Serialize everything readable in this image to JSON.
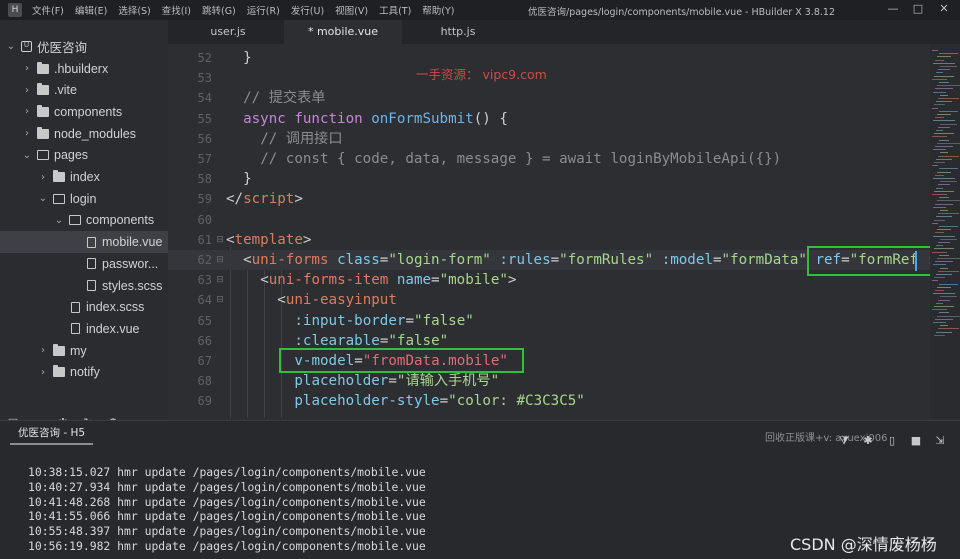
{
  "app": {
    "logo": "H",
    "window_title": "优医咨询/pages/login/components/mobile.vue - HBuilder X 3.8.12",
    "menu": [
      "文件(F)",
      "编辑(E)",
      "选择(S)",
      "查找(I)",
      "跳转(G)",
      "运行(R)",
      "发行(U)",
      "视图(V)",
      "工具(T)",
      "帮助(Y)"
    ],
    "window_buttons": [
      "—",
      "□",
      "✕"
    ]
  },
  "sidebar": {
    "items": [
      {
        "label": "优医咨询",
        "type": "project",
        "chevron": "v",
        "indent": 0
      },
      {
        "label": ".hbuilderx",
        "type": "folder",
        "chevron": ">",
        "indent": 1
      },
      {
        "label": ".vite",
        "type": "folder",
        "chevron": ">",
        "indent": 1
      },
      {
        "label": "components",
        "type": "folder",
        "chevron": ">",
        "indent": 1
      },
      {
        "label": "node_modules",
        "type": "folder",
        "chevron": ">",
        "indent": 1
      },
      {
        "label": "pages",
        "type": "folder-open",
        "chevron": "v",
        "indent": 1
      },
      {
        "label": "index",
        "type": "folder",
        "chevron": ">",
        "indent": 2
      },
      {
        "label": "login",
        "type": "folder-open",
        "chevron": "v",
        "indent": 2
      },
      {
        "label": "components",
        "type": "folder-open",
        "chevron": "v",
        "indent": 3
      },
      {
        "label": "mobile.vue",
        "type": "file",
        "chevron": "",
        "indent": 4,
        "selected": true
      },
      {
        "label": "passwor...",
        "type": "file",
        "chevron": "",
        "indent": 4
      },
      {
        "label": "styles.scss",
        "type": "file",
        "chevron": "",
        "indent": 4
      },
      {
        "label": "index.scss",
        "type": "file",
        "chevron": "",
        "indent": 3
      },
      {
        "label": "index.vue",
        "type": "file",
        "chevron": "",
        "indent": 3
      },
      {
        "label": "my",
        "type": "folder",
        "chevron": ">",
        "indent": 2
      },
      {
        "label": "notify",
        "type": "folder",
        "chevron": ">",
        "indent": 2
      }
    ],
    "toolbar_icons": [
      "folder-list-icon",
      "binoculars-icon",
      "bug-icon",
      "refresh-icon",
      "plugin-icon"
    ]
  },
  "tabs": [
    {
      "label": "user.js",
      "active": false
    },
    {
      "label": "* mobile.vue",
      "active": true
    },
    {
      "label": "http.js",
      "active": false
    }
  ],
  "editor": {
    "watermark": "一手资源： vipc9.com",
    "lines": [
      {
        "n": "52",
        "fold": "",
        "indent": 1,
        "segs": [
          [
            "}",
            "txt"
          ]
        ]
      },
      {
        "n": "53",
        "fold": "",
        "indent": 0,
        "segs": []
      },
      {
        "n": "54",
        "fold": "",
        "indent": 1,
        "segs": [
          [
            "// 提交表单",
            "cmt"
          ]
        ]
      },
      {
        "n": "55",
        "fold": "",
        "indent": 1,
        "segs": [
          [
            "async ",
            "kw"
          ],
          [
            "function ",
            "kw"
          ],
          [
            "onFormSubmit",
            "fn"
          ],
          [
            "() {",
            "txt"
          ]
        ]
      },
      {
        "n": "56",
        "fold": "",
        "indent": 2,
        "segs": [
          [
            "// 调用接口",
            "cmt"
          ]
        ]
      },
      {
        "n": "57",
        "fold": "",
        "indent": 2,
        "segs": [
          [
            "// const { code, data, message } = await loginByMobileApi({})",
            "cmt"
          ]
        ]
      },
      {
        "n": "58",
        "fold": "",
        "indent": 1,
        "segs": [
          [
            "}",
            "txt"
          ]
        ]
      },
      {
        "n": "59",
        "fold": "",
        "indent": 0,
        "segs": [
          [
            "</",
            "txt"
          ],
          [
            "script",
            "tag"
          ],
          [
            ">",
            "txt"
          ]
        ]
      },
      {
        "n": "60",
        "fold": "",
        "indent": 0,
        "segs": []
      },
      {
        "n": "61",
        "fold": "⊟",
        "indent": 0,
        "segs": [
          [
            "<",
            "txt"
          ],
          [
            "template",
            "tag"
          ],
          [
            ">",
            "txt"
          ]
        ]
      },
      {
        "n": "62",
        "fold": "⊟",
        "indent": 1,
        "current": true,
        "segs": [
          [
            "<",
            "txt"
          ],
          [
            "uni-forms ",
            "tag"
          ],
          [
            "class",
            "attr"
          ],
          [
            "=",
            "txt"
          ],
          [
            "\"login-form\"",
            "str"
          ],
          [
            " ",
            "txt"
          ],
          [
            ":rules",
            "attr"
          ],
          [
            "=",
            "txt"
          ],
          [
            "\"formRules\"",
            "str"
          ],
          [
            " ",
            "txt"
          ],
          [
            ":model",
            "attr"
          ],
          [
            "=",
            "txt"
          ],
          [
            "\"formData\"",
            "str"
          ],
          [
            " ",
            "txt"
          ],
          [
            "ref",
            "attr"
          ],
          [
            "=",
            "txt"
          ],
          [
            "\"formRef",
            "str"
          ],
          [
            " :",
            "txt"
          ]
        ]
      },
      {
        "n": "63",
        "fold": "⊟",
        "indent": 2,
        "segs": [
          [
            "<",
            "txt"
          ],
          [
            "uni-forms-item ",
            "tag"
          ],
          [
            "name",
            "attr"
          ],
          [
            "=",
            "txt"
          ],
          [
            "\"mobile\"",
            "str"
          ],
          [
            ">",
            "txt"
          ]
        ]
      },
      {
        "n": "64",
        "fold": "⊟",
        "indent": 3,
        "segs": [
          [
            "<",
            "txt"
          ],
          [
            "uni-easyinput",
            "tag"
          ]
        ]
      },
      {
        "n": "65",
        "fold": "",
        "indent": 4,
        "segs": [
          [
            ":input-border",
            "attr"
          ],
          [
            "=",
            "txt"
          ],
          [
            "\"false\"",
            "str"
          ]
        ]
      },
      {
        "n": "66",
        "fold": "",
        "indent": 4,
        "segs": [
          [
            ":clearable",
            "attr"
          ],
          [
            "=",
            "txt"
          ],
          [
            "\"false\"",
            "str"
          ]
        ]
      },
      {
        "n": "67",
        "fold": "",
        "indent": 4,
        "segs": [
          [
            "v-model",
            "attr"
          ],
          [
            "=",
            "txt"
          ],
          [
            "\"fromData.mobile\"",
            "red"
          ]
        ]
      },
      {
        "n": "68",
        "fold": "",
        "indent": 4,
        "segs": [
          [
            "placeholder",
            "attr"
          ],
          [
            "=",
            "txt"
          ],
          [
            "\"请输入手机号\"",
            "str"
          ]
        ]
      },
      {
        "n": "69",
        "fold": "",
        "indent": 4,
        "segs": [
          [
            "placeholder-style",
            "attr"
          ],
          [
            "=",
            "txt"
          ],
          [
            "\"color: #C3C3C5\"",
            "str"
          ]
        ]
      }
    ]
  },
  "console": {
    "tab_label": "优医咨询 - H5",
    "note": "回收正版课+v: axuexi006",
    "icons": [
      "filter-icon",
      "bug-icon",
      "mobile-preview-icon",
      "stop-icon",
      "export-icon",
      "maximize-icon"
    ],
    "logs": [
      "10:38:15.027 hmr update /pages/login/components/mobile.vue",
      "10:40:27.934 hmr update /pages/login/components/mobile.vue",
      "10:41:48.268 hmr update /pages/login/components/mobile.vue",
      "10:41:55.066 hmr update /pages/login/components/mobile.vue",
      "10:55:48.397 hmr update /pages/login/components/mobile.vue",
      "10:56:19.982 hmr update /pages/login/components/mobile.vue"
    ]
  },
  "overlay": {
    "csdn": "CSDN @深情废杨杨"
  }
}
